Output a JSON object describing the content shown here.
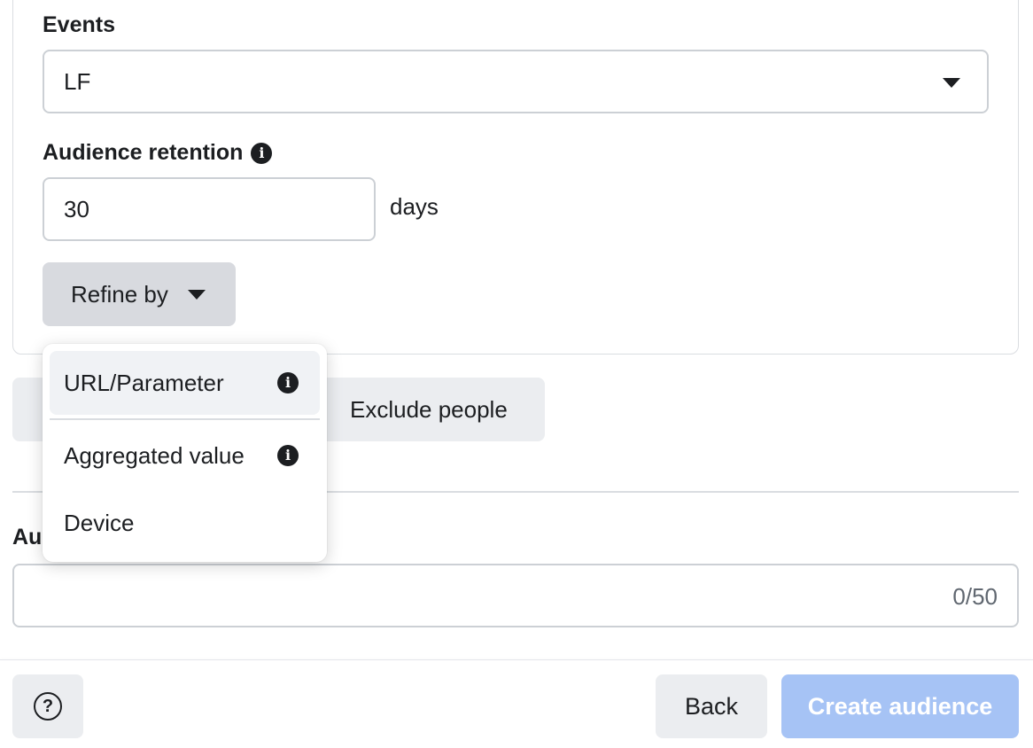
{
  "rule": {
    "events_label": "Events",
    "events_value": "LF",
    "retention_label": "Audience retention",
    "retention_value": "30",
    "retention_unit": "days",
    "refine_label": "Refine by"
  },
  "actions": {
    "exclude_label": "Exclude people"
  },
  "audience_name": {
    "label": "Au",
    "value": "",
    "counter": "0/50"
  },
  "refine_menu": {
    "items": [
      {
        "label": "URL/Parameter",
        "icon": "info-icon",
        "active": true
      },
      {
        "label": "Aggregated value",
        "icon": "info-icon"
      },
      {
        "label": "Device"
      }
    ]
  },
  "footer": {
    "help_icon": "question-circle-icon",
    "help_glyph": "?",
    "back_label": "Back",
    "create_label": "Create audience"
  },
  "icons": {
    "info_glyph": "i"
  },
  "colors": {
    "primary_disabled": "#a6c3f5",
    "secondary_button": "#ebedf0",
    "refine_button": "#d8dadf"
  }
}
